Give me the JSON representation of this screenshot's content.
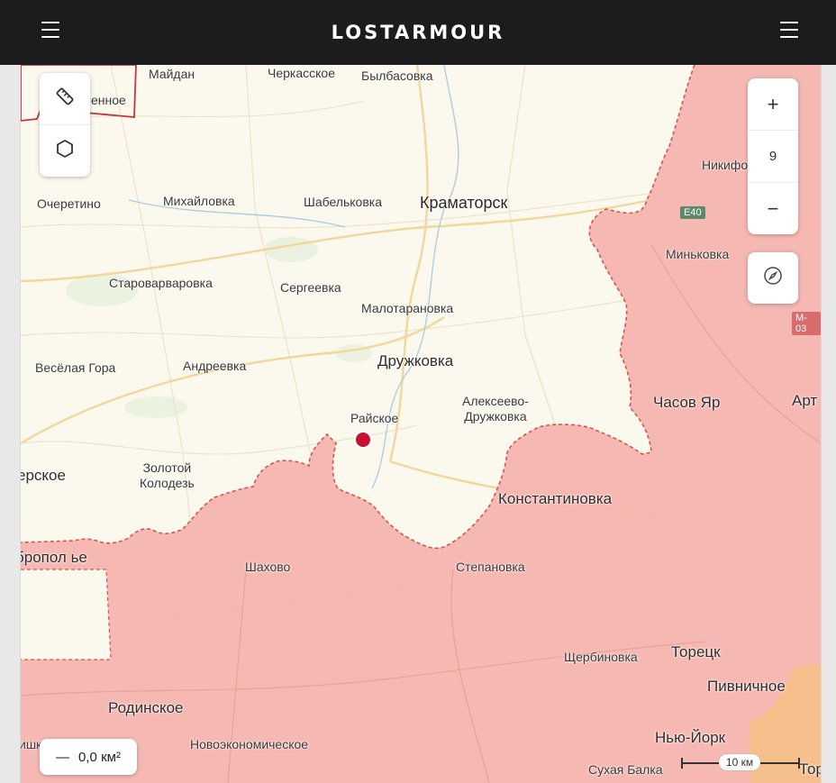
{
  "header": {
    "brand": "LOSTARMOUR"
  },
  "icons": {
    "menu_left": "hamburger-menu-icon",
    "menu_right": "hamburger-menu-icon",
    "ruler": "ruler-icon",
    "polygon": "hexagon-icon",
    "compass": "compass-icon"
  },
  "controls": {
    "zoom_in": "+",
    "zoom_level": "9",
    "zoom_out": "−"
  },
  "area_tool": {
    "minus": "—",
    "value": "0,0 км²"
  },
  "scale": {
    "label": "10 км"
  },
  "roads": {
    "e40": "E40",
    "m03": "M-03"
  },
  "colors": {
    "occupied": "#f4b4ae",
    "occupied_border": "#d8544a",
    "other_zone": "#f6c08a",
    "land": "#fbf8ee",
    "marker": "#c8102e"
  },
  "places": {
    "maydan": "Майдан",
    "cherkasskoe": "Черкасское",
    "bylbasovka": "Былбасовка",
    "enoe": "енное",
    "nikif": "Никифо",
    "ocheretino": "Очеретино",
    "mikhaylovka": "Михайловка",
    "shabelkovka": "Шабельковка",
    "kramatorsk": "Краматорск",
    "minkovka": "Миньковка",
    "starovarvarovka": "Староварваровка",
    "sergeevka": "Сергеевка",
    "malotaranovka": "Малотарановка",
    "veselaya_gora": "Весёлая Гора",
    "andreevka": "Андреевка",
    "druzhkovka": "Дружковка",
    "chasov_yar": "Часов Яр",
    "art": "Арт",
    "rayskoe": "Райское",
    "alekseevo_1": "Алексеево-",
    "alekseevo_2": "Дружковка",
    "erskoe": "ерское",
    "zolotoy_1": "Золотой",
    "zolotoy_2": "Колодезь",
    "konstantinovka": "Константиновка",
    "bropolye": "бропол ье",
    "shakhovo": "Шахово",
    "stepanovka": "Степановка",
    "shcherbinovka": "Щербиновка",
    "toretsk": "Торецк",
    "rodinskoe": "Родинское",
    "pivnichnoe": "Пивничное",
    "novoekonomicheskoe": "Новоэкономическое",
    "nyu_york": "Нью-Йорк",
    "sukhaya_balka": "Сухая Балка",
    "tor": "Тор",
    "ishk": "ишк"
  }
}
